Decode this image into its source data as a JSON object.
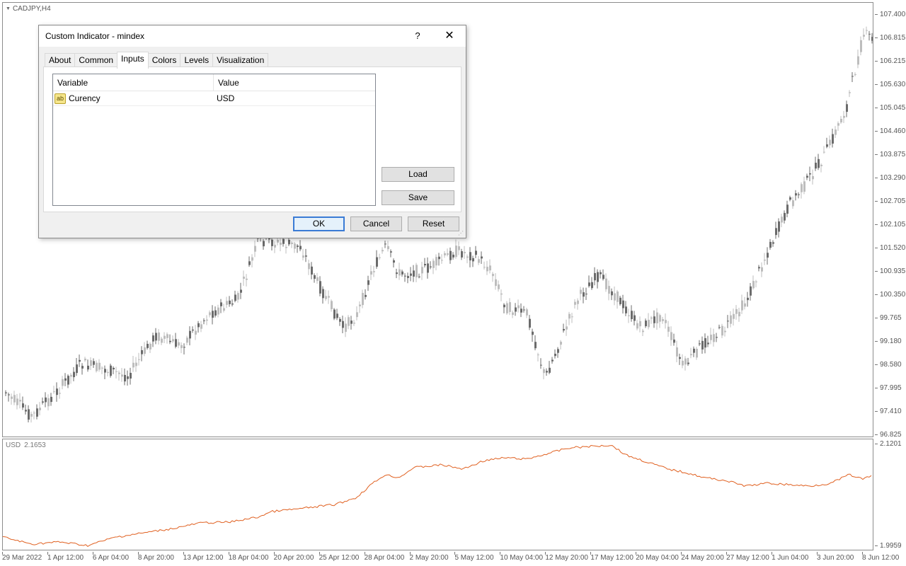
{
  "chart": {
    "symbol": "CADJPY,H4",
    "indicator_label": "USD",
    "indicator_value": "2.1653",
    "colors": {
      "bear_candle": "#6b6b6b",
      "bull_candle": "#bdbdbd",
      "indicator_line": "#e06020"
    }
  },
  "price_scale": [
    "107.400",
    "106.815",
    "106.215",
    "105.630",
    "105.045",
    "104.460",
    "103.875",
    "103.290",
    "102.705",
    "102.105",
    "101.520",
    "100.935",
    "100.350",
    "99.765",
    "99.180",
    "98.580",
    "97.995",
    "97.410",
    "96.825"
  ],
  "indicator_scale": [
    "2.1201",
    "1.9959"
  ],
  "time_scale": [
    "29 Mar 2022",
    "1 Apr 12:00",
    "6 Apr 04:00",
    "8 Apr 20:00",
    "13 Apr 12:00",
    "18 Apr 04:00",
    "20 Apr 20:00",
    "25 Apr 12:00",
    "28 Apr 04:00",
    "2 May 20:00",
    "5 May 12:00",
    "10 May 04:00",
    "12 May 20:00",
    "17 May 12:00",
    "20 May 04:00",
    "24 May 20:00",
    "27 May 12:00",
    "1 Jun 04:00",
    "3 Jun 20:00",
    "8 Jun 12:00"
  ],
  "dialog": {
    "title": "Custom Indicator - mindex",
    "help": "?",
    "close": "✕",
    "tabs": [
      "About",
      "Common",
      "Inputs",
      "Colors",
      "Levels",
      "Visualization"
    ],
    "active_tab": "Inputs",
    "grid": {
      "headers": [
        "Variable",
        "Value"
      ],
      "rows": [
        {
          "icon": "ab",
          "variable": "Curency",
          "value": "USD"
        }
      ]
    },
    "buttons": {
      "load": "Load",
      "save": "Save",
      "ok": "OK",
      "cancel": "Cancel",
      "reset": "Reset"
    }
  }
}
